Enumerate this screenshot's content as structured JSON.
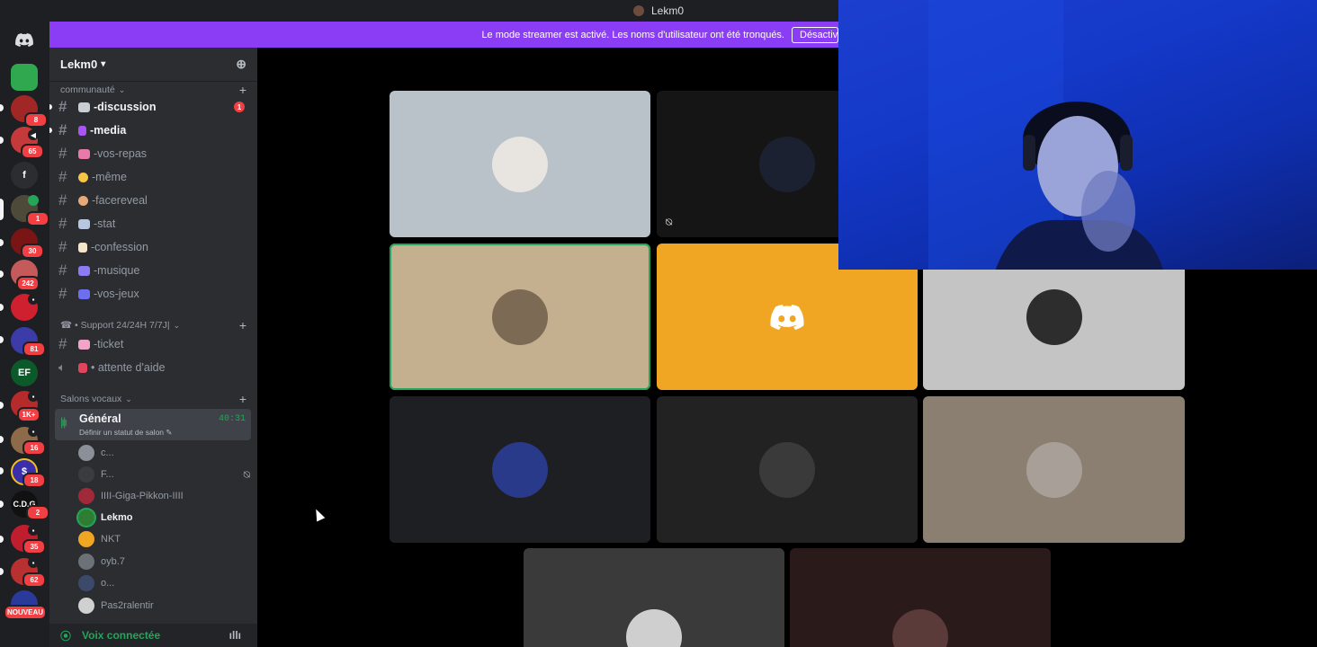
{
  "window": {
    "title": "Lekm0"
  },
  "banner": {
    "message": "Le mode streamer est activé. Les noms d'utilisateur ont été tronqués.",
    "button": "Désactiver"
  },
  "rail": {
    "badges": [
      "8",
      "65",
      "1",
      "30",
      "242",
      "81",
      "1K+",
      "16",
      "18",
      "2",
      "35",
      "62"
    ],
    "new_label": "NOUVEAU",
    "letter_server": "f",
    "cdg_label": "C.D.G",
    "ef_label": "EF"
  },
  "guild": {
    "name": "Lekm0"
  },
  "categories": {
    "communaute": "communauté",
    "support": "☎ • Support 24/24H 7/7J|",
    "voice": "Salons vocaux"
  },
  "channels": [
    {
      "name": "-discussion",
      "unread": true,
      "count": "1",
      "color": "#c9cdd4"
    },
    {
      "name": "-media",
      "unread": true,
      "color": "#a855f7"
    },
    {
      "name": "-vos-repas",
      "color": "#e879a9"
    },
    {
      "name": "-même",
      "color": "#f7c548"
    },
    {
      "name": "-facereveal",
      "color": "#e7a87c"
    },
    {
      "name": "-stat",
      "color": "#b8c7e0"
    },
    {
      "name": "-confession",
      "color": "#f5e6c8"
    },
    {
      "name": "-musique",
      "color": "#8b7cf6"
    },
    {
      "name": "-vos-jeux",
      "color": "#6d6ff0"
    }
  ],
  "support_channels": [
    {
      "name": "-ticket",
      "type": "text",
      "color": "#f0a5c8"
    },
    {
      "name": "• attente d'aide",
      "type": "voice",
      "color": "#e0455c"
    }
  ],
  "voice_channel": {
    "name": "Général",
    "status": "Définir un statut de salon",
    "timer": "40:31",
    "users": [
      {
        "name": "c...",
        "color": "#8a8f98"
      },
      {
        "name": "F...",
        "color": "#3a3c40",
        "muted": true
      },
      {
        "name": "IIII-Giga-Pikkon-IIII",
        "color": "#a02a3a"
      },
      {
        "name": "Lekmo",
        "color": "#2e7d32",
        "me": true
      },
      {
        "name": "NKT",
        "color": "#f0a623"
      },
      {
        "name": "oyb.7",
        "color": "#6c7077"
      },
      {
        "name": "o...",
        "color": "#3b4a6b"
      },
      {
        "name": "Pas2ralentir",
        "color": "#d0d0d0"
      }
    ]
  },
  "connection": {
    "label": "Voix connectée"
  },
  "tiles": [
    {
      "bg": "#b9c1c9",
      "avatar": "#e8e4df"
    },
    {
      "bg": "#151515",
      "avatar": "#1b2130",
      "muted": true
    },
    {
      "bg": "#c4b08f",
      "avatar": "#7d6a54",
      "speaking": true
    },
    {
      "bg": "#f0a623",
      "avatar": "discord"
    },
    {
      "bg": "#c4c4c4",
      "avatar": "#2d2d2d"
    },
    {
      "bg": "#1e1f22",
      "avatar": "#2a3a8a"
    },
    {
      "bg": "#222222",
      "avatar": "#3a3a3a"
    },
    {
      "bg": "#8a7f70",
      "avatar": "#a8a098"
    },
    {
      "bg": "#3a3a3a",
      "avatar": "#cfcfcf"
    },
    {
      "bg": "#2b1a1a",
      "avatar": "#5b3a3a"
    }
  ]
}
